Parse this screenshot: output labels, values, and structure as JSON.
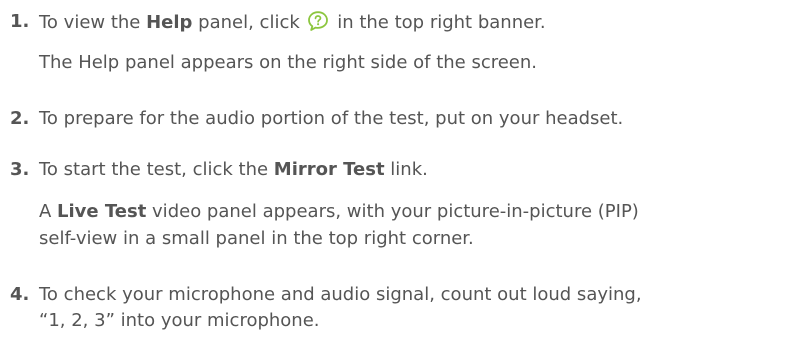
{
  "steps": [
    {
      "number": "1.",
      "text_before": "To view the ",
      "bold": "Help",
      "text_mid": " panel, click ",
      "icon": "help-speech-bubble-icon",
      "text_after": " in the top right banner.",
      "note": "The Help panel appears on the right side of the screen."
    },
    {
      "number": "2.",
      "text": "To prepare for the audio portion of the test, put on your headset."
    },
    {
      "number": "3.",
      "text_before": "To start the test, click the ",
      "bold": "Mirror Test",
      "text_after": " link.",
      "note_prefix": "A ",
      "note_bold": "Live Test",
      "note_line1_rest": " video panel appears, with your picture-in-picture (PIP)",
      "note_line2": "self-view in a small panel in the top right corner."
    },
    {
      "number": "4.",
      "line1": "To check your microphone and audio signal, count out loud saying,",
      "line2": "“1, 2, 3” into your microphone."
    }
  ],
  "colors": {
    "text": "#555555",
    "icon": "#8cc63f"
  }
}
